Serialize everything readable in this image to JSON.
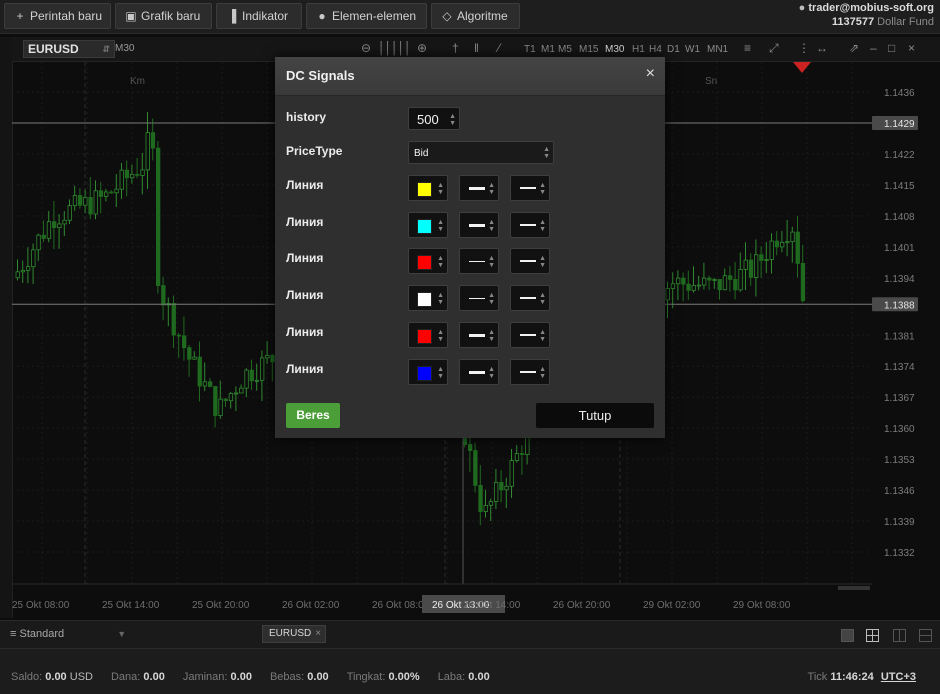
{
  "toolbar": {
    "buttons": [
      {
        "icon": "plus-icon",
        "glyph": "+",
        "label": "Perintah baru"
      },
      {
        "icon": "chart-icon",
        "glyph": "▣",
        "label": "Grafik baru"
      },
      {
        "icon": "indicator-icon",
        "glyph": "▐",
        "label": "Indikator"
      },
      {
        "icon": "elements-icon",
        "glyph": "●",
        "label": "Elemen-elemen"
      },
      {
        "icon": "algorithm-icon",
        "glyph": "◇",
        "label": "Algoritme"
      }
    ],
    "account": {
      "email": "trader@mobius-soft.org",
      "number": "1137577",
      "fund": "Dollar Fund"
    }
  },
  "chart": {
    "symbol": "EURUSD",
    "timeframe_label": "M30",
    "timeframes": [
      "T1",
      "M1",
      "M5",
      "M15",
      "M30",
      "H1",
      "H4",
      "D1",
      "W1",
      "MN1"
    ],
    "active_timeframe": "M30",
    "day_labels": [
      "Km",
      "Sn"
    ],
    "price_ticks": [
      "1.1436",
      "1.1429",
      "1.1422",
      "1.1415",
      "1.1408",
      "1.1401",
      "1.1394",
      "1.1388",
      "1.1381",
      "1.1374",
      "1.1367",
      "1.1360",
      "1.1353",
      "1.1346",
      "1.1339",
      "1.1332"
    ],
    "highlighted_prices": [
      "1.1429",
      "1.1388"
    ],
    "time_labels": [
      "25 Okt 08:00",
      "25 Okt 14:00",
      "25 Okt 20:00",
      "26 Okt 02:00",
      "26 Okt 08:00",
      "26 Okt 13:00",
      "26 Okt 14:00",
      "26 Okt 20:00",
      "29 Okt 02:00",
      "29 Okt 08:00"
    ],
    "crosshair_time": "26 Okt 13:00",
    "colors": {
      "bull": "#2f8a2f",
      "bear": "#1f6a1f",
      "marker": "#cc2222"
    }
  },
  "bottom": {
    "layout": "Standard",
    "tab_symbol": "EURUSD",
    "status": [
      {
        "label": "Saldo:",
        "value": "0.00",
        "unit": "USD"
      },
      {
        "label": "Dana:",
        "value": "0.00"
      },
      {
        "label": "Jaminan:",
        "value": "0.00"
      },
      {
        "label": "Bebas:",
        "value": "0.00"
      },
      {
        "label": "Tingkat:",
        "value": "0.00%"
      },
      {
        "label": "Laba:",
        "value": "0.00"
      }
    ],
    "tick_label": "Tick",
    "tick_time": "11:46:24",
    "timezone": "UTC+3"
  },
  "dialog": {
    "title": "DC Signals",
    "close_glyph": "×",
    "history_label": "history",
    "history_value": "500",
    "pricetype_label": "PriceType",
    "pricetype_value": "Bid",
    "lines": [
      {
        "label": "Линия",
        "color": "#ffff00",
        "width1": "thick",
        "width2": "thick"
      },
      {
        "label": "Линия",
        "color": "#00ffff",
        "width1": "thick",
        "width2": "thick"
      },
      {
        "label": "Линия",
        "color": "#ff0000",
        "width1": "thin",
        "width2": "thick"
      },
      {
        "label": "Линия",
        "color": "#ffffff",
        "width1": "thin",
        "width2": "thick"
      },
      {
        "label": "Линия",
        "color": "#ff0000",
        "width1": "thick",
        "width2": "thick"
      },
      {
        "label": "Линия",
        "color": "#0000ff",
        "width1": "thick",
        "width2": "thick"
      }
    ],
    "ok_label": "Beres",
    "close_label": "Tutup",
    "ok_color": "#4c9f38"
  }
}
